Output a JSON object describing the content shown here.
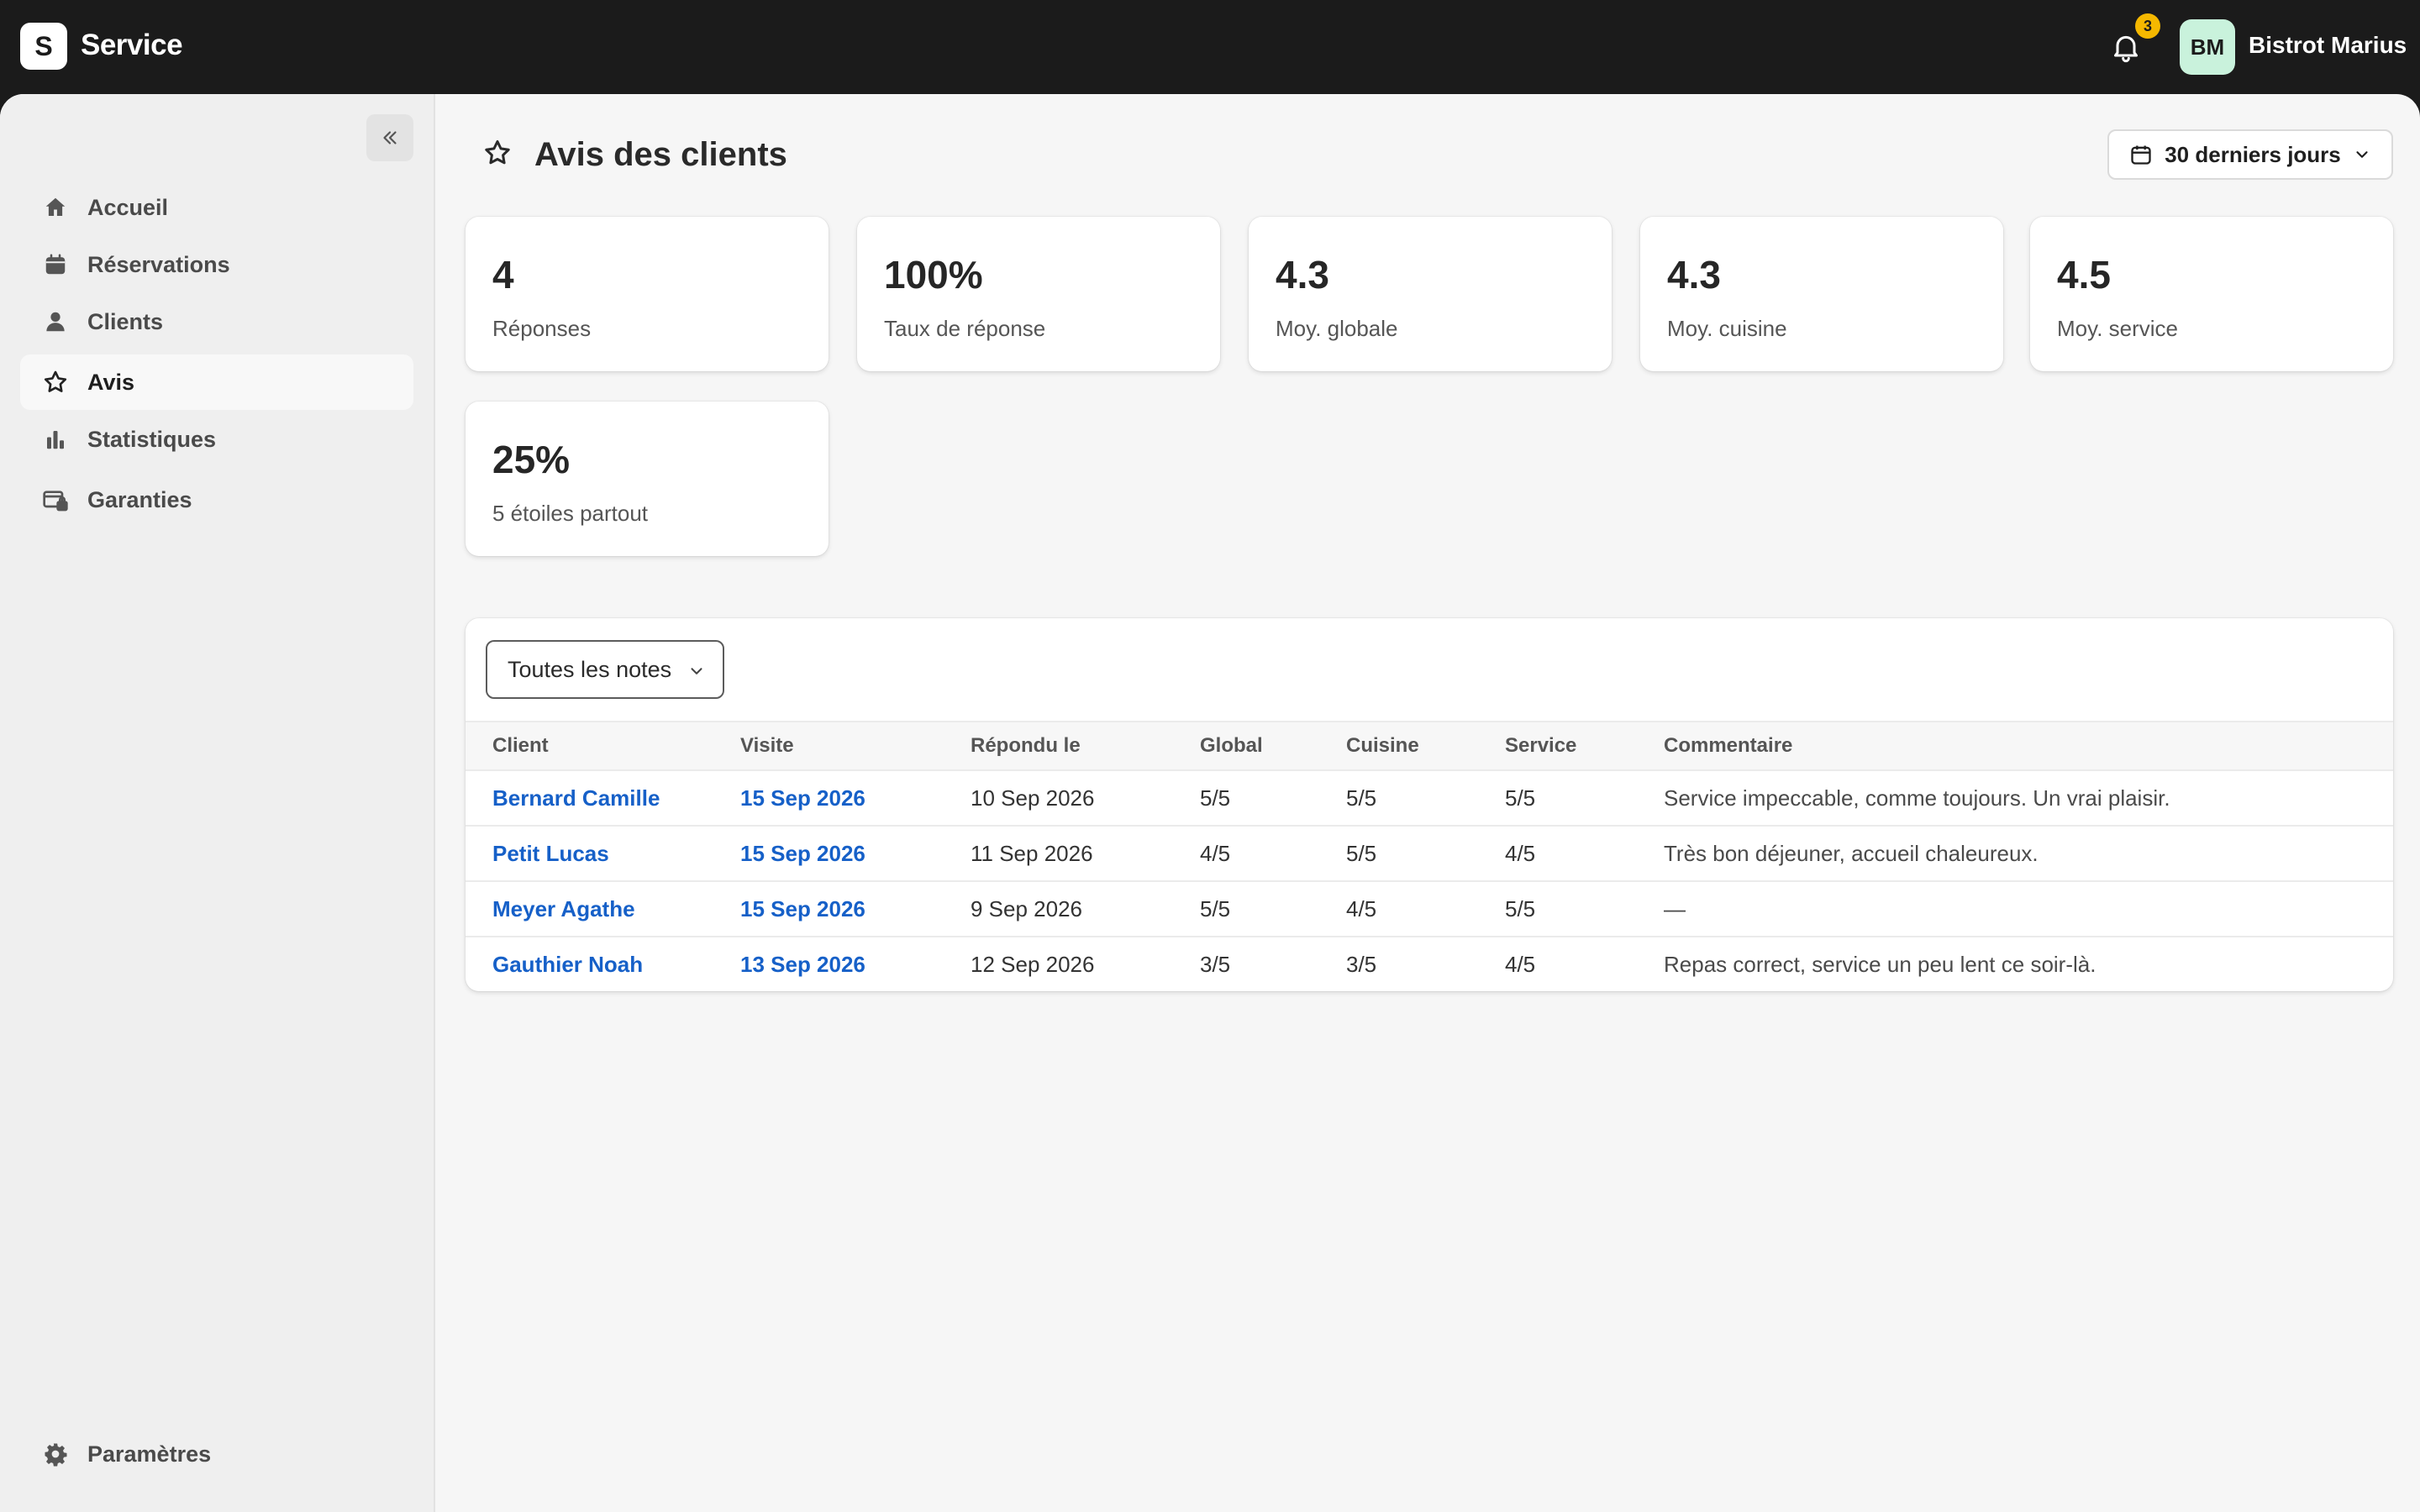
{
  "app": {
    "logo_letter": "S",
    "title": "Service"
  },
  "header": {
    "notifications_count": "3",
    "avatar_initials": "BM",
    "user_name": "Bistrot Marius"
  },
  "sidebar": {
    "items": [
      {
        "label": "Accueil",
        "icon": "home-icon"
      },
      {
        "label": "Réservations",
        "icon": "calendar-icon"
      },
      {
        "label": "Clients",
        "icon": "user-icon"
      },
      {
        "label": "Avis",
        "icon": "star-icon",
        "active": true
      },
      {
        "label": "Statistiques",
        "icon": "bar-chart-icon"
      },
      {
        "label": "Garanties",
        "icon": "card-lock-icon"
      }
    ],
    "settings_label": "Paramètres"
  },
  "page": {
    "title": "Avis des clients",
    "period_label": "30 derniers jours"
  },
  "kpis": [
    {
      "value": "4",
      "label": "Réponses"
    },
    {
      "value": "100%",
      "label": "Taux de réponse"
    },
    {
      "value": "4.3",
      "label": "Moy. globale"
    },
    {
      "value": "4.3",
      "label": "Moy. cuisine"
    },
    {
      "value": "4.5",
      "label": "Moy. service"
    },
    {
      "value": "25%",
      "label": "5 étoiles partout"
    }
  ],
  "filter": {
    "selected": "Toutes les notes"
  },
  "table": {
    "headers": [
      "Client",
      "Visite",
      "Répondu le",
      "Global",
      "Cuisine",
      "Service",
      "Commentaire"
    ],
    "rows": [
      {
        "client": "Bernard Camille",
        "visit": "15 Sep 2026",
        "responded": "10 Sep 2026",
        "global": "5/5",
        "cuisine": "5/5",
        "service": "5/5",
        "comment": "Service impeccable, comme toujours. Un vrai plaisir."
      },
      {
        "client": "Petit Lucas",
        "visit": "15 Sep 2026",
        "responded": "11 Sep 2026",
        "global": "4/5",
        "cuisine": "5/5",
        "service": "4/5",
        "comment": "Très bon déjeuner, accueil chaleureux."
      },
      {
        "client": "Meyer Agathe",
        "visit": "15 Sep 2026",
        "responded": "9 Sep 2026",
        "global": "5/5",
        "cuisine": "4/5",
        "service": "5/5",
        "comment": "—"
      },
      {
        "client": "Gauthier Noah",
        "visit": "13 Sep 2026",
        "responded": "12 Sep 2026",
        "global": "3/5",
        "cuisine": "3/5",
        "service": "4/5",
        "comment": "Repas correct, service un peu lent ce soir-là."
      }
    ]
  },
  "colors": {
    "topbar": "#1b1b1b",
    "link": "#1660c8",
    "badge": "#f5b800",
    "avatar_bg": "#c9f2dc"
  }
}
